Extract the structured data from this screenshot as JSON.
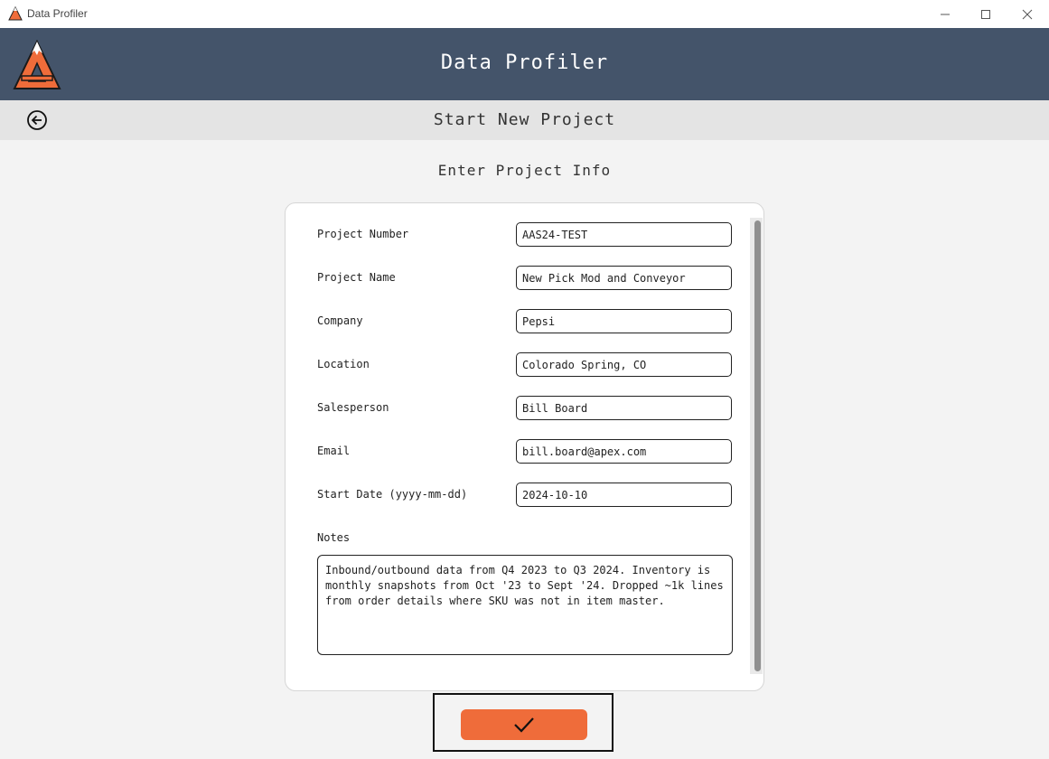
{
  "window": {
    "title": "Data Profiler"
  },
  "header": {
    "app_title": "Data Profiler"
  },
  "subheader": {
    "title": "Start New Project"
  },
  "section": {
    "title": "Enter Project Info"
  },
  "form": {
    "fields": [
      {
        "label": "Project Number",
        "value": "AAS24-TEST"
      },
      {
        "label": "Project Name",
        "value": "New Pick Mod and Conveyor"
      },
      {
        "label": "Company",
        "value": "Pepsi"
      },
      {
        "label": "Location",
        "value": "Colorado Spring, CO"
      },
      {
        "label": "Salesperson",
        "value": "Bill Board"
      },
      {
        "label": "Email",
        "value": "bill.board@apex.com"
      },
      {
        "label": "Start Date (yyyy-mm-dd)",
        "value": "2024-10-10"
      }
    ],
    "notes_label": "Notes",
    "notes_value": "Inbound/outbound data from Q4 2023 to Q3 2024. Inventory is monthly snapshots from Oct '23 to Sept '24. Dropped ~1k lines from order details where SKU was not in item master."
  },
  "icons": {
    "app": "apex-mountain-logo",
    "back": "back-arrow-circle-icon",
    "submit": "checkmark-icon"
  },
  "colors": {
    "header_bg": "#44546a",
    "subheader_bg": "#e4e4e4",
    "accent": "#ef6c3a"
  }
}
